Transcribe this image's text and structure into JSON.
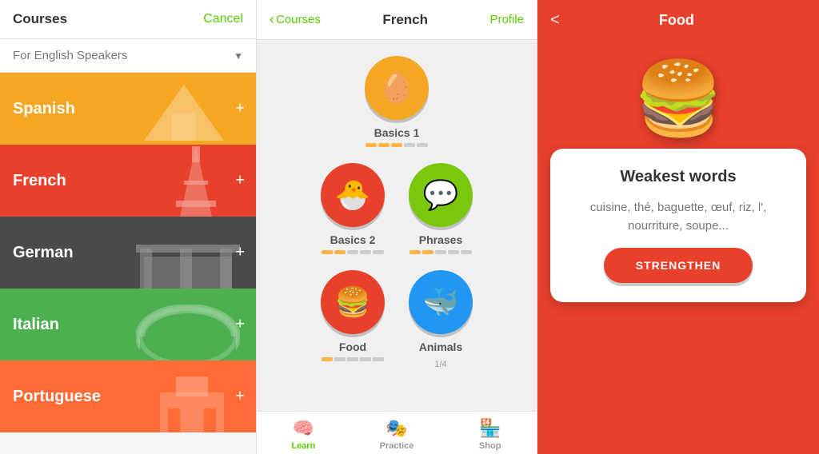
{
  "panel1": {
    "header": {
      "title": "Courses",
      "cancel": "Cancel"
    },
    "filter": {
      "label": "For English Speakers",
      "arrow": "▼"
    },
    "courses": [
      {
        "name": "Spanish",
        "class": "spanish",
        "icon": "🏛",
        "emoji": "🏯"
      },
      {
        "name": "French",
        "class": "french",
        "icon": "🗼",
        "emoji": "🗼"
      },
      {
        "name": "German",
        "class": "german",
        "icon": "🏛",
        "emoji": "🏛"
      },
      {
        "name": "Italian",
        "class": "italian",
        "icon": "🏟",
        "emoji": "🏟"
      },
      {
        "name": "Portuguese",
        "class": "portuguese",
        "icon": "🏖",
        "emoji": "🏖"
      }
    ],
    "plus": "+"
  },
  "panel2": {
    "header": {
      "back": "Courses",
      "title": "French",
      "profile": "Profile"
    },
    "skills": [
      {
        "name": "Basics 1",
        "color": "orange",
        "emoji": "🥚",
        "progress": [
          true,
          true,
          true,
          false,
          false
        ],
        "sub": ""
      },
      {
        "name": "Basics 2",
        "color": "red",
        "emoji": "🐣",
        "progress": [
          true,
          true,
          false,
          false,
          false
        ],
        "sub": ""
      },
      {
        "name": "Phrases",
        "color": "green",
        "emoji": "💬",
        "progress": [
          true,
          true,
          false,
          false,
          false
        ],
        "sub": ""
      },
      {
        "name": "Food",
        "color": "red",
        "emoji": "🍔",
        "progress": [
          true,
          false,
          false,
          false,
          false
        ],
        "sub": ""
      },
      {
        "name": "Animals",
        "color": "blue",
        "emoji": "🐳",
        "progress": [],
        "sub": "1/4"
      }
    ],
    "tabs": [
      {
        "icon": "🧠",
        "label": "Learn",
        "active": true
      },
      {
        "icon": "🎭",
        "label": "Practice",
        "active": false
      },
      {
        "icon": "🏪",
        "label": "Shop",
        "active": false
      }
    ]
  },
  "panel3": {
    "header": {
      "back": "<",
      "title": "Food"
    },
    "burger": "🍔",
    "card": {
      "title": "Weakest words",
      "words": "cuisine, thé,\nbaguette, œuf, riz, l',\nnourriture, soupe...",
      "button": "STRENGTHEN"
    }
  }
}
